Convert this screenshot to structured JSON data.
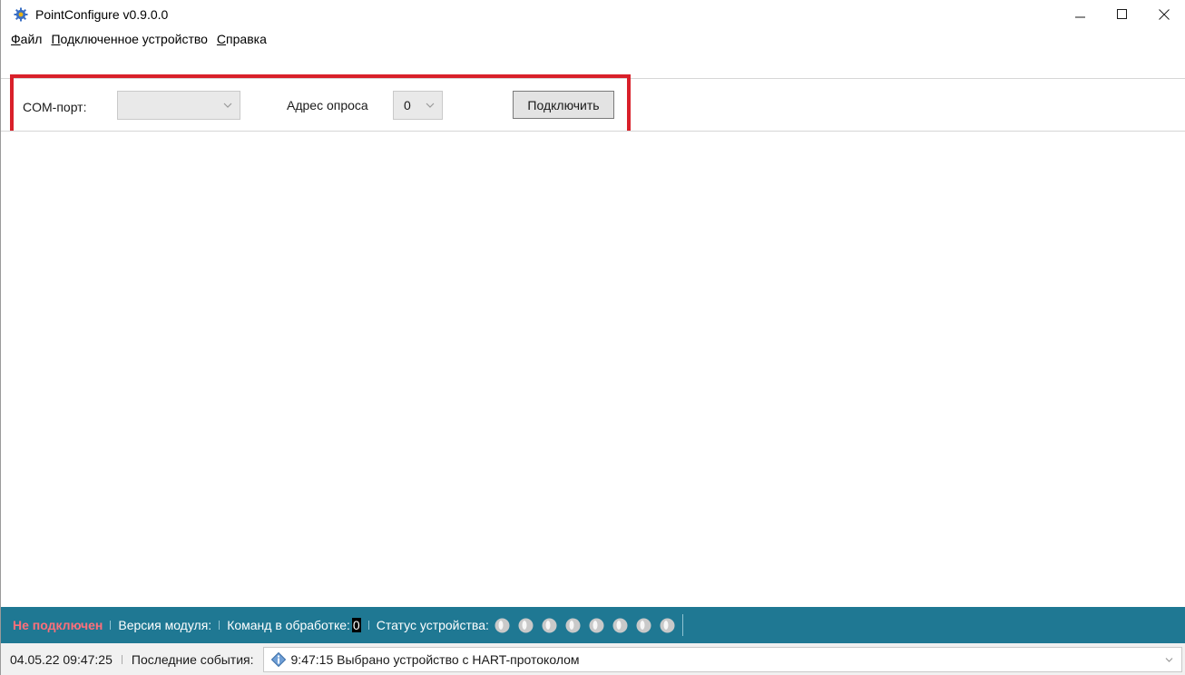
{
  "window": {
    "title": "PointConfigure v0.9.0.0"
  },
  "menu": {
    "items": [
      {
        "label_mnemonic": "Ф",
        "label_rest": "айл"
      },
      {
        "label_mnemonic": "П",
        "label_rest": "одключенное устройство"
      },
      {
        "label_mnemonic": "С",
        "label_rest": "правка"
      }
    ]
  },
  "toolbar": {
    "com_port_label": "COM-порт:",
    "com_port_value": "",
    "poll_address_label": "Адрес опроса",
    "poll_address_value": "0",
    "connect_button": "Подключить"
  },
  "status": {
    "connection": "Не подключен",
    "module_version_label": "Версия модуля:",
    "module_version_value": "",
    "commands_label": "Команд в обработке:",
    "commands_value": "0",
    "device_status_label": "Статус устройства:",
    "leds": [
      "off",
      "off",
      "off",
      "off",
      "off",
      "off",
      "off",
      "off"
    ]
  },
  "events": {
    "timestamp": "04.05.22 09:47:25",
    "label": "Последние события:",
    "last_event": "9:47:15 Выбрано устройство с HART-протоколом"
  },
  "colors": {
    "highlight": "#d9202a",
    "statusbar": "#1f7893",
    "not_connected": "#ff6f7a"
  }
}
